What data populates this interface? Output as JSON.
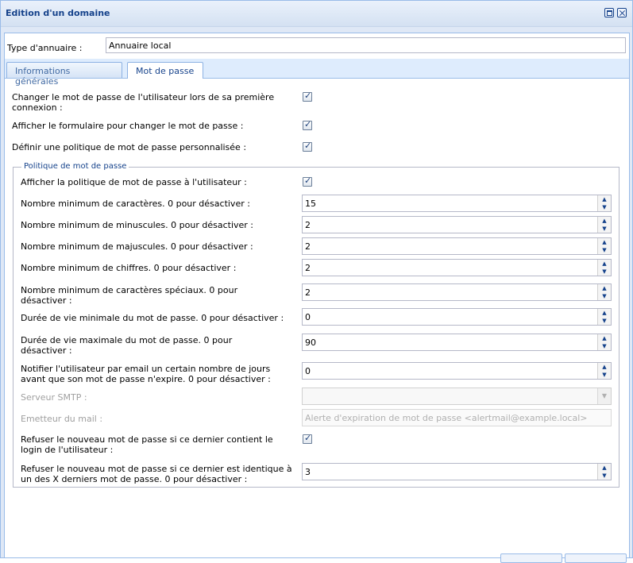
{
  "window": {
    "title": "Edition d'un domaine"
  },
  "directory": {
    "label": "Type d'annuaire :",
    "value": "Annuaire local"
  },
  "tabs": [
    {
      "label": "Informations générales",
      "active": false
    },
    {
      "label": "Mot de passe",
      "active": true
    }
  ],
  "options": [
    {
      "label": "Changer le mot de passe de l'utilisateur lors de sa première connexion :",
      "checked": true
    },
    {
      "label": "Afficher le formulaire pour changer le mot de passe :",
      "checked": true
    },
    {
      "label": "Définir une politique de mot de passe personnalisée :",
      "checked": true
    }
  ],
  "policy": {
    "legend": "Politique de mot de passe",
    "show_policy": {
      "label": "Afficher la politique de mot de passe à l'utilisateur :",
      "checked": true
    },
    "fields": [
      {
        "label": "Nombre minimum de caractères. 0 pour désactiver :",
        "value": "15"
      },
      {
        "label": "Nombre minimum de minuscules. 0 pour désactiver :",
        "value": "2"
      },
      {
        "label": "Nombre minimum de majuscules. 0 pour désactiver :",
        "value": "2"
      },
      {
        "label": "Nombre minimum de chiffres. 0 pour désactiver :",
        "value": "2"
      },
      {
        "label": "Nombre minimum de caractères spéciaux. 0 pour désactiver :",
        "value": "2"
      },
      {
        "label": "Durée de vie minimale du mot de passe. 0 pour désactiver :",
        "value": "0"
      },
      {
        "label": "Durée de vie maximale du mot de passe. 0 pour désactiver :",
        "value": "90"
      },
      {
        "label": "Notifier l'utilisateur par email un certain nombre de jours avant que son mot de passe n'expire. 0 pour désactiver :",
        "value": "0"
      }
    ],
    "smtp": {
      "label": "Serveur SMTP :",
      "value": ""
    },
    "sender": {
      "label": "Emetteur du mail :",
      "placeholder": "Alerte d'expiration de mot de passe <alertmail@example.local>"
    },
    "refuse_login": {
      "label": "Refuser le nouveau mot de passe si ce dernier contient le login de l'utilisateur :",
      "checked": true
    },
    "history": {
      "label": "Refuser le nouveau mot de passe si ce dernier est identique à un des X derniers mot de passe. 0 pour désactiver :",
      "value": "3"
    }
  },
  "icons": {
    "checkmark": "✓",
    "spin_up": "▲",
    "spin_down": "▼",
    "combo_trigger": "▼"
  }
}
